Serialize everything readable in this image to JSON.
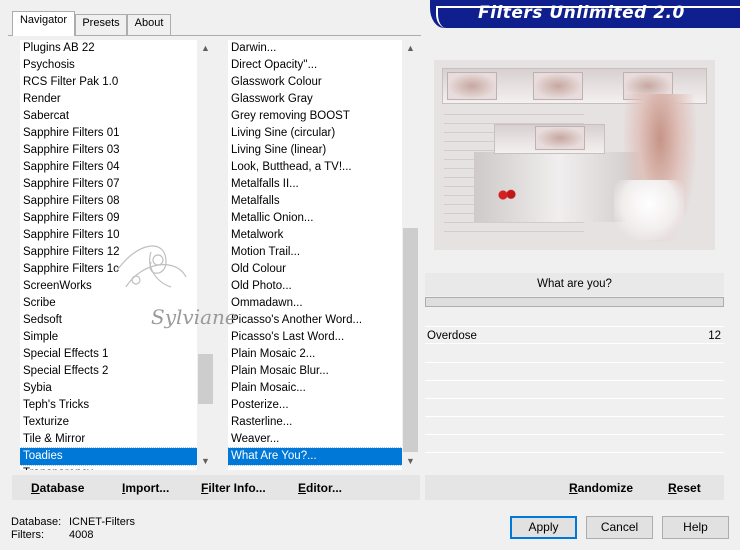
{
  "tabs": [
    {
      "label": "Navigator"
    },
    {
      "label": "Presets"
    },
    {
      "label": "About"
    }
  ],
  "banner": {
    "title": "Filters Unlimited 2.0"
  },
  "categories": {
    "items": [
      "Plugins AB 22",
      "Psychosis",
      "RCS Filter Pak 1.0",
      "Render",
      "Sabercat",
      "Sapphire Filters 01",
      "Sapphire Filters 03",
      "Sapphire Filters 04",
      "Sapphire Filters 07",
      "Sapphire Filters 08",
      "Sapphire Filters 09",
      "Sapphire Filters 10",
      "Sapphire Filters 12",
      "Sapphire Filters 1c",
      "ScreenWorks",
      "Scribe",
      "Sedsoft",
      "Simple",
      "Special Effects 1",
      "Special Effects 2",
      "Sybia",
      "Teph's Tricks",
      "Texturize",
      "Tile & Mirror",
      "Toadies",
      "Transparency"
    ],
    "selected": "Toadies"
  },
  "filters": {
    "items": [
      "Darwin...",
      "Direct Opacity''...",
      "Glasswork Colour",
      "Glasswork Gray",
      "Grey removing BOOST",
      "Living Sine (circular)",
      "Living Sine (linear)",
      "Look, Butthead, a TV!...",
      "Metalfalls II...",
      "Metalfalls",
      "Metallic Onion...",
      "Metalwork",
      "Motion Trail...",
      "Old Colour",
      "Old Photo...",
      "Ommadawn...",
      "Picasso's Another Word...",
      "Picasso's Last Word...",
      "Plain Mosaic 2...",
      "Plain Mosaic Blur...",
      "Plain Mosaic...",
      "Posterize...",
      "Rasterline...",
      "Weaver...",
      "What Are You?..."
    ],
    "selected": "What Are You?..."
  },
  "filter_panel": {
    "title": "What are you?",
    "param_name": "Overdose",
    "param_value": "12"
  },
  "watermark": {
    "text": "Sylviane"
  },
  "toolbar": {
    "database": "Database",
    "import": "Import...",
    "filter_info": "Filter Info...",
    "editor": "Editor...",
    "randomize": "Randomize",
    "reset": "Reset"
  },
  "status": {
    "database_label": "Database:",
    "database_value": "ICNET-Filters",
    "filters_label": "Filters:",
    "filters_value": "4008"
  },
  "buttons": {
    "apply": "Apply",
    "cancel": "Cancel",
    "help": "Help"
  },
  "colors": {
    "banner": "#0f1f8e",
    "selection": "#0078d7"
  }
}
